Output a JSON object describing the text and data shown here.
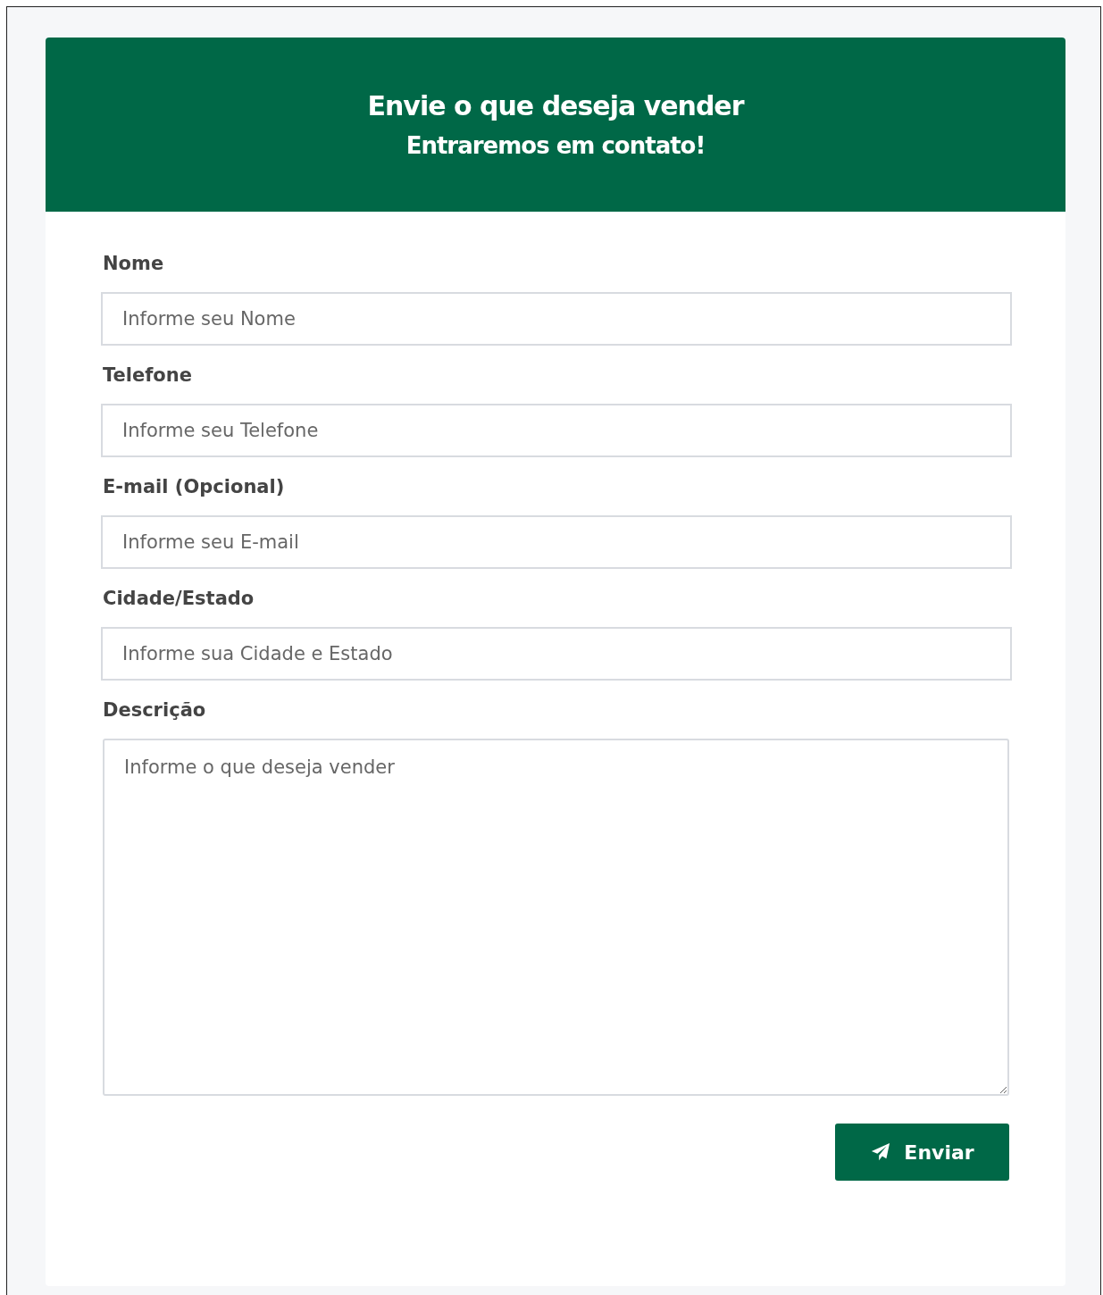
{
  "header": {
    "title": "Envie o que deseja vender",
    "subtitle": "Entraremos em contato!"
  },
  "fields": [
    {
      "kind": "input",
      "label": "Nome",
      "placeholder": "Informe seu Nome"
    },
    {
      "kind": "input",
      "label": "Telefone",
      "placeholder": "Informe seu Telefone"
    },
    {
      "kind": "input",
      "label": "E-mail (Opcional)",
      "placeholder": "Informe seu E-mail"
    },
    {
      "kind": "input",
      "label": "Cidade/Estado",
      "placeholder": "Informe sua Cidade e Estado"
    },
    {
      "kind": "textarea",
      "label": "Descrição",
      "placeholder": "Informe o que deseja vender"
    }
  ],
  "submit": {
    "label": "Enviar"
  }
}
